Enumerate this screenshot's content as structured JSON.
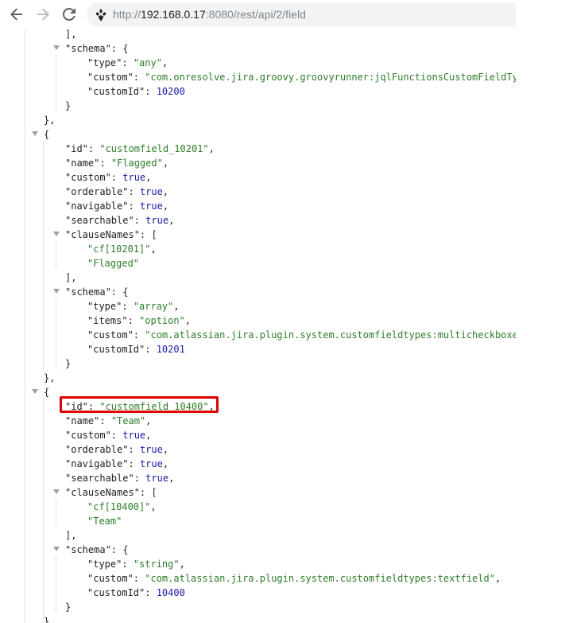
{
  "browser": {
    "url_scheme": "http://",
    "url_host": "192.168.0.17",
    "url_path": ":8080/rest/api/2/field",
    "icons": {
      "back": "arrow-left-icon",
      "forward": "arrow-right-icon",
      "reload": "reload-icon",
      "site": "jira-site-icon"
    }
  },
  "json_lines": {
    "l00": "],",
    "l01": {
      "key": "\"schema\"",
      "rest": ": {"
    },
    "l02": {
      "key": "\"type\"",
      "value": "\"any\"",
      "end": ","
    },
    "l03": {
      "key": "\"custom\"",
      "value": "\"com.onresolve.jira.groovy.groovyrunner:jqlFunctionsCustomFieldTyp"
    },
    "l04": {
      "key": "\"customId\"",
      "value": "10200"
    },
    "l05": "}",
    "l06": "},",
    "l07": "{",
    "l08": {
      "key": "\"id\"",
      "value": "\"customfield_10201\"",
      "end": ","
    },
    "l09": {
      "key": "\"name\"",
      "value": "\"Flagged\"",
      "end": ","
    },
    "l10": {
      "key": "\"custom\"",
      "value": "true",
      "end": ","
    },
    "l11": {
      "key": "\"orderable\"",
      "value": "true",
      "end": ","
    },
    "l12": {
      "key": "\"navigable\"",
      "value": "true",
      "end": ","
    },
    "l13": {
      "key": "\"searchable\"",
      "value": "true",
      "end": ","
    },
    "l14": {
      "key": "\"clauseNames\"",
      "rest": ": ["
    },
    "l15": {
      "value": "\"cf[10201]\"",
      "end": ","
    },
    "l16": {
      "value": "\"Flagged\""
    },
    "l17": "],",
    "l18": {
      "key": "\"schema\"",
      "rest": ": {"
    },
    "l19": {
      "key": "\"type\"",
      "value": "\"array\"",
      "end": ","
    },
    "l20": {
      "key": "\"items\"",
      "value": "\"option\"",
      "end": ","
    },
    "l21": {
      "key": "\"custom\"",
      "value": "\"com.atlassian.jira.plugin.system.customfieldtypes:multicheckboxes"
    },
    "l22": {
      "key": "\"customId\"",
      "value": "10201"
    },
    "l23": "}",
    "l24": "},",
    "l25": "{",
    "l26": {
      "key": "\"id\"",
      "value": "\"customfield_10400\"",
      "end": ","
    },
    "l27": {
      "key": "\"name\"",
      "value": "\"Team\"",
      "end": ","
    },
    "l28": {
      "key": "\"custom\"",
      "value": "true",
      "end": ","
    },
    "l29": {
      "key": "\"orderable\"",
      "value": "true",
      "end": ","
    },
    "l30": {
      "key": "\"navigable\"",
      "value": "true",
      "end": ","
    },
    "l31": {
      "key": "\"searchable\"",
      "value": "true",
      "end": ","
    },
    "l32": {
      "key": "\"clauseNames\"",
      "rest": ": ["
    },
    "l33": {
      "value": "\"cf[10400]\"",
      "end": ","
    },
    "l34": {
      "value": "\"Team\""
    },
    "l35": "],",
    "l36": {
      "key": "\"schema\"",
      "rest": ": {"
    },
    "l37": {
      "key": "\"type\"",
      "value": "\"string\"",
      "end": ","
    },
    "l38": {
      "key": "\"custom\"",
      "value": "\"com.atlassian.jira.plugin.system.customfieldtypes:textfield\"",
      "end": ","
    },
    "l39": {
      "key": "\"customId\"",
      "value": "10400"
    },
    "l40": "}",
    "l41": "},"
  },
  "colors": {
    "key": "#202124",
    "string": "#2d7d28",
    "literal": "#1a1aa6",
    "highlight": "#e00000"
  }
}
